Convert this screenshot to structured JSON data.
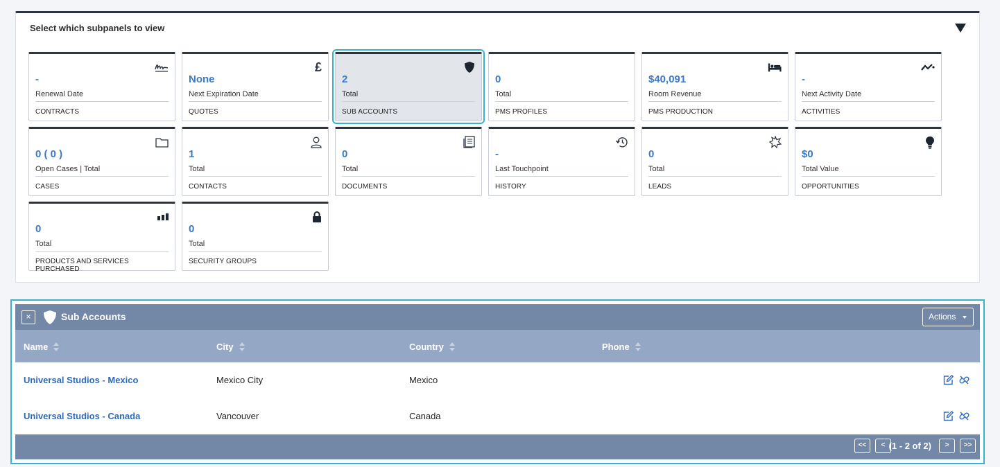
{
  "selector": {
    "title": "Select which subpanels to view",
    "toggle_icon": "triangle-down-icon"
  },
  "tiles": [
    {
      "value": "-",
      "sub": "Renewal Date",
      "label": "CONTRACTS",
      "icon": "signature-icon",
      "active": false
    },
    {
      "value": "None",
      "sub": "Next Expiration Date",
      "label": "QUOTES",
      "icon": "pound-icon",
      "icon_glyph": "£",
      "active": false
    },
    {
      "value": "2",
      "sub": "Total",
      "label": "SUB ACCOUNTS",
      "icon": "shield-icon",
      "active": true
    },
    {
      "value": "0",
      "sub": "Total",
      "label": "PMS PROFILES",
      "icon": "",
      "active": false
    },
    {
      "value": "$40,091",
      "sub": "Room Revenue",
      "label": "PMS PRODUCTION",
      "icon": "bed-icon",
      "active": false
    },
    {
      "value": "-",
      "sub": "Next Activity Date",
      "label": "ACTIVITIES",
      "icon": "activity-icon",
      "active": false
    },
    {
      "value": "0 ( 0 )",
      "sub": "Open Cases | Total",
      "label": "CASES",
      "icon": "folder-icon",
      "active": false
    },
    {
      "value": "1",
      "sub": "Total",
      "label": "CONTACTS",
      "icon": "user-icon",
      "active": false
    },
    {
      "value": "0",
      "sub": "Total",
      "label": "DOCUMENTS",
      "icon": "document-icon",
      "active": false
    },
    {
      "value": "-",
      "sub": "Last Touchpoint",
      "label": "HISTORY",
      "icon": "history-icon",
      "active": false
    },
    {
      "value": "0",
      "sub": "Total",
      "label": "LEADS",
      "icon": "star-burst-icon",
      "active": false
    },
    {
      "value": "$0",
      "sub": "Total Value",
      "label": "OPPORTUNITIES",
      "icon": "lightbulb-icon",
      "active": false
    },
    {
      "value": "0",
      "sub": "Total",
      "label": "PRODUCTS AND SERVICES PURCHASED",
      "icon": "bar-chart-icon",
      "active": false
    },
    {
      "value": "0",
      "sub": "Total",
      "label": "SECURITY GROUPS",
      "icon": "lock-icon",
      "active": false
    }
  ],
  "panel": {
    "close_label": "×",
    "title": "Sub Accounts",
    "actions_label": "Actions",
    "columns": [
      "Name",
      "City",
      "Country",
      "Phone"
    ],
    "rows": [
      {
        "name": "Universal Studios - Mexico",
        "city": "Mexico City",
        "country": "Mexico",
        "phone": ""
      },
      {
        "name": "Universal Studios - Canada",
        "city": "Vancouver",
        "country": "Canada",
        "phone": ""
      }
    ],
    "pager": {
      "first": "<<",
      "prev": "<",
      "count": "(1 - 2 of 2)",
      "next": ">",
      "last": ">>"
    }
  },
  "colors": {
    "accent": "#37b2cb",
    "header_bg": "#7388a7",
    "column_header_bg": "#94a8c6",
    "link": "#2f69b8",
    "tile_value": "#3a78c8",
    "tile_top": "#2b3440"
  }
}
